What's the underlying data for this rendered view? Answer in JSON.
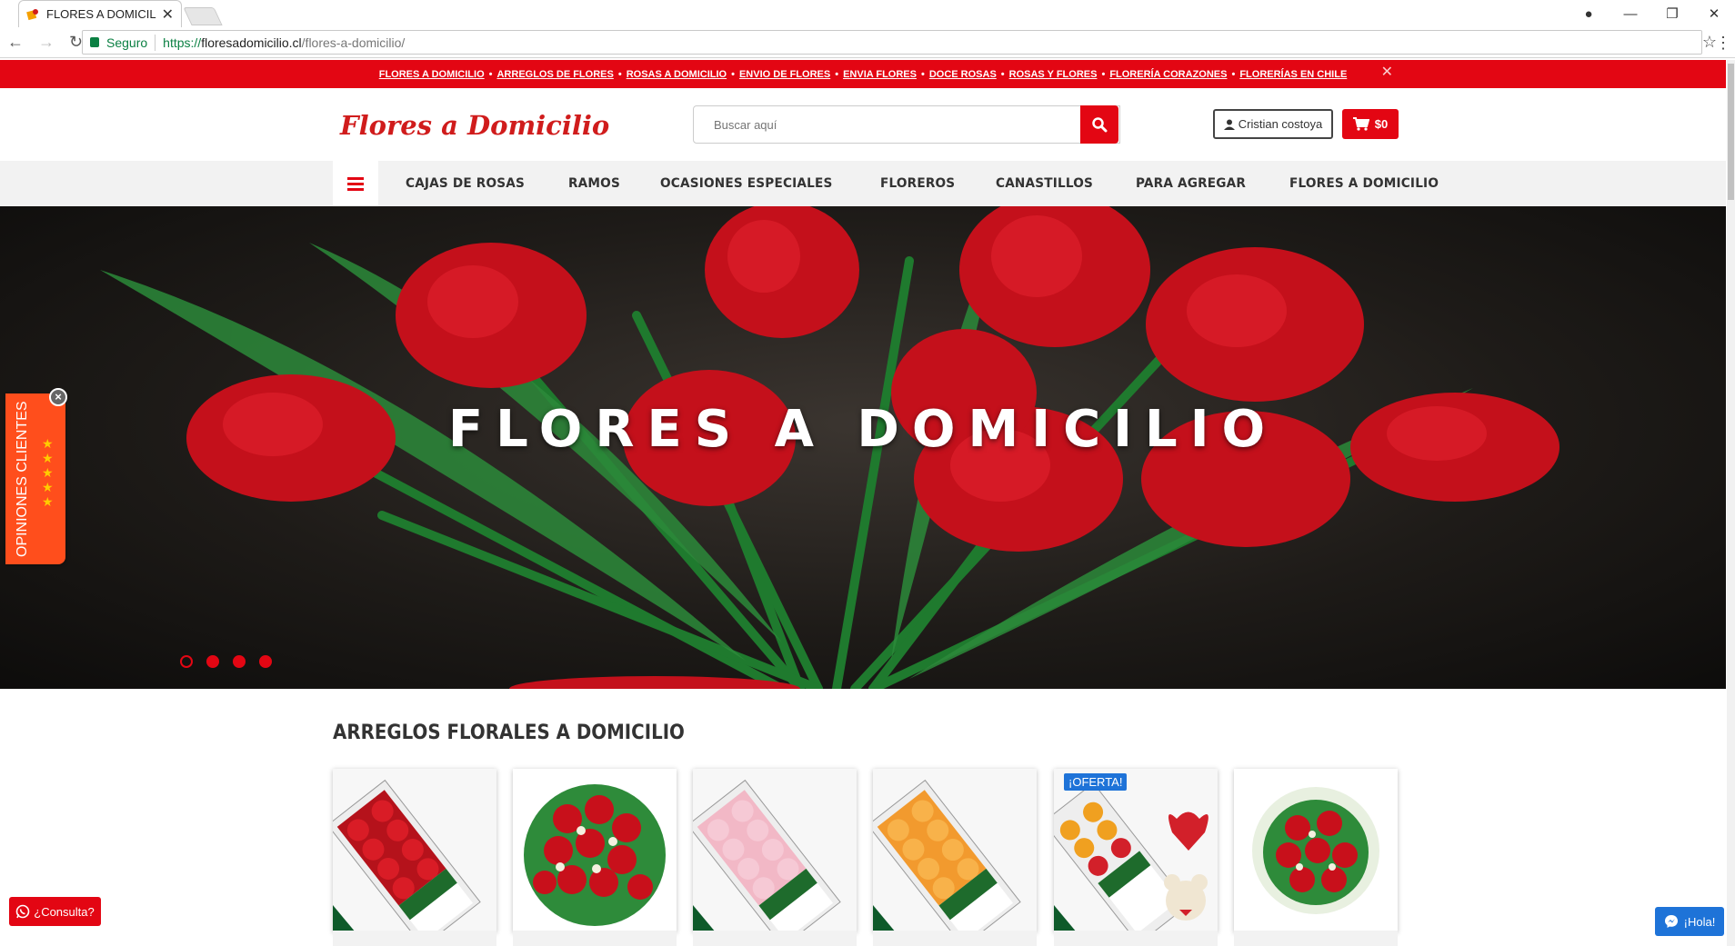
{
  "browser": {
    "tab_title": "FLORES A DOMICILIO, EN",
    "secure_label": "Seguro",
    "url_protocol": "https://",
    "url_host": "floresadomicilio.cl",
    "url_path": "/flores-a-domicilio/"
  },
  "top_links": [
    "FLORES A DOMICILIO",
    "ARREGLOS DE FLORES",
    "ROSAS A DOMICILIO",
    "ENVIO DE FLORES",
    "ENVIA FLORES",
    "DOCE ROSAS",
    "ROSAS Y FLORES",
    "FLORERÍA CORAZONES",
    "FLORERÍAS EN CHILE"
  ],
  "header": {
    "logo_text": "Flores a Domicilio",
    "search_placeholder": "Buscar aquí",
    "user_label": "Cristian costoya",
    "cart_label": "$0"
  },
  "nav": {
    "items": [
      "CAJAS DE ROSAS",
      "RAMOS",
      "OCASIONES ESPECIALES",
      "FLOREROS",
      "CANASTILLOS",
      "PARA AGREGAR",
      "FLORES A DOMICILIO"
    ]
  },
  "hero": {
    "title": "FLORES A DOMICILIO",
    "slide_count": 4,
    "active_slide": 1
  },
  "widgets": {
    "opinions_label": "OPINIONES CLIENTES",
    "stars": 5,
    "consulta_label": "¿Consulta?",
    "hola_label": "¡Hola!"
  },
  "section": {
    "title": "ARREGLOS FLORALES A DOMICILIO",
    "badge": "¡OFERTA!"
  },
  "colors": {
    "brand_red": "#e30613",
    "opinions_orange": "#ff4e1c",
    "chat_blue": "#1e73d8"
  }
}
